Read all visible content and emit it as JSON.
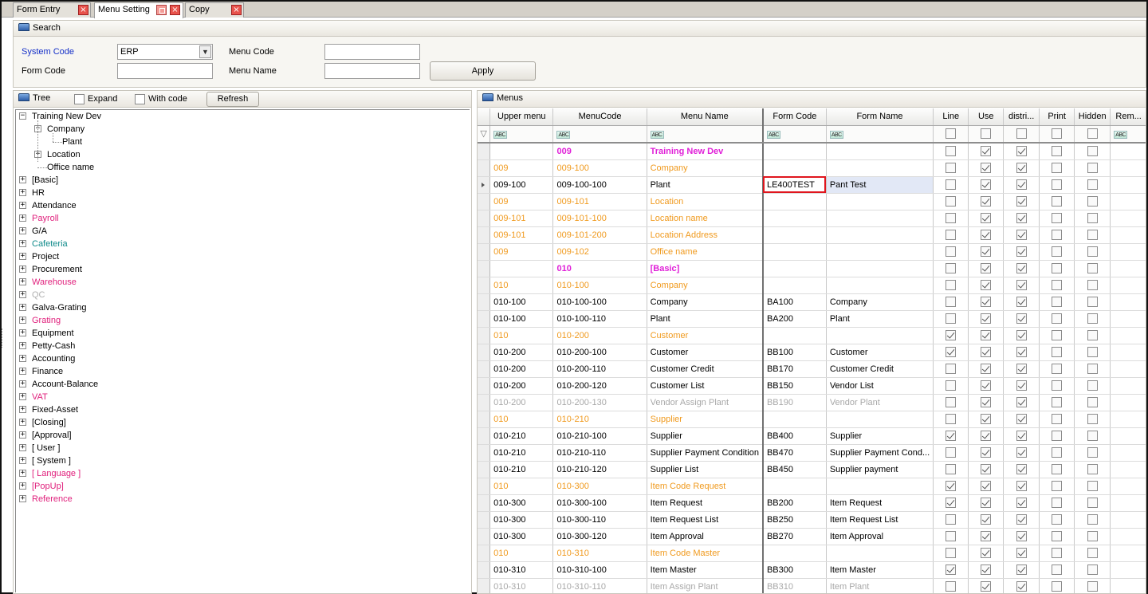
{
  "tabs": [
    {
      "label": "Form Entry"
    },
    {
      "label": "Menu Setting"
    },
    {
      "label": "Copy"
    }
  ],
  "search": {
    "title": "Search",
    "system_code_label": "System Code",
    "system_code_value": "ERP",
    "menu_code_label": "Menu Code",
    "menu_code_value": "",
    "form_code_label": "Form Code",
    "form_code_value": "",
    "menu_name_label": "Menu Name",
    "menu_name_value": "",
    "apply_label": "Apply"
  },
  "tree": {
    "title": "Tree",
    "expand_label": "Expand",
    "with_code_label": "With code",
    "refresh_label": "Refresh",
    "nodes": [
      {
        "label": "Training New Dev",
        "level": 0,
        "toggle": "minus",
        "color": "#000000"
      },
      {
        "label": "Company",
        "level": 1,
        "toggle": "minus",
        "color": "#000000"
      },
      {
        "label": "Plant",
        "level": 2,
        "toggle": "none",
        "color": "#000000"
      },
      {
        "label": "Location",
        "level": 1,
        "toggle": "plus",
        "color": "#000000"
      },
      {
        "label": "Office name",
        "level": 1,
        "toggle": "none",
        "color": "#000000"
      },
      {
        "label": "[Basic]",
        "level": 0,
        "toggle": "plus",
        "color": "#000000"
      },
      {
        "label": "HR",
        "level": 0,
        "toggle": "plus",
        "color": "#000000"
      },
      {
        "label": "Attendance",
        "level": 0,
        "toggle": "plus",
        "color": "#000000"
      },
      {
        "label": "Payroll",
        "level": 0,
        "toggle": "plus",
        "color": "#e0207c"
      },
      {
        "label": "G/A",
        "level": 0,
        "toggle": "plus",
        "color": "#000000"
      },
      {
        "label": "Cafeteria",
        "level": 0,
        "toggle": "plus",
        "color": "#0f8a8a"
      },
      {
        "label": "Project",
        "level": 0,
        "toggle": "plus",
        "color": "#000000"
      },
      {
        "label": "Procurement",
        "level": 0,
        "toggle": "plus",
        "color": "#000000"
      },
      {
        "label": "Warehouse",
        "level": 0,
        "toggle": "plus",
        "color": "#e0207c"
      },
      {
        "label": "QC",
        "level": 0,
        "toggle": "plus",
        "color": "#b0b0b0"
      },
      {
        "label": "Galva-Grating",
        "level": 0,
        "toggle": "plus",
        "color": "#000000"
      },
      {
        "label": "Grating",
        "level": 0,
        "toggle": "plus",
        "color": "#e0207c"
      },
      {
        "label": "Equipment",
        "level": 0,
        "toggle": "plus",
        "color": "#000000"
      },
      {
        "label": "Petty-Cash",
        "level": 0,
        "toggle": "plus",
        "color": "#000000"
      },
      {
        "label": "Accounting",
        "level": 0,
        "toggle": "plus",
        "color": "#000000"
      },
      {
        "label": "Finance",
        "level": 0,
        "toggle": "plus",
        "color": "#000000"
      },
      {
        "label": "Account-Balance",
        "level": 0,
        "toggle": "plus",
        "color": "#000000"
      },
      {
        "label": "VAT",
        "level": 0,
        "toggle": "plus",
        "color": "#e0207c"
      },
      {
        "label": "Fixed-Asset",
        "level": 0,
        "toggle": "plus",
        "color": "#000000"
      },
      {
        "label": "[Closing]",
        "level": 0,
        "toggle": "plus",
        "color": "#000000"
      },
      {
        "label": "[Approval]",
        "level": 0,
        "toggle": "plus",
        "color": "#000000"
      },
      {
        "label": "[ User ]",
        "level": 0,
        "toggle": "plus",
        "color": "#000000"
      },
      {
        "label": "[ System ]",
        "level": 0,
        "toggle": "plus",
        "color": "#000000"
      },
      {
        "label": "[ Language ]",
        "level": 0,
        "toggle": "plus",
        "color": "#e0207c"
      },
      {
        "label": "[PopUp]",
        "level": 0,
        "toggle": "plus",
        "color": "#e0207c"
      },
      {
        "label": "Reference",
        "level": 0,
        "toggle": "plus",
        "color": "#e0207c"
      }
    ]
  },
  "menus": {
    "title": "Menus",
    "columns": [
      "Upper menu",
      "MenuCode",
      "Menu Name",
      "Form Code",
      "Form Name",
      "Line",
      "Use",
      "distri...",
      "Print",
      "Hidden",
      "Rem..."
    ],
    "rows": [
      {
        "style": "magenta",
        "upper": "",
        "code": "009",
        "name": "Training New Dev",
        "form_code": "",
        "form_name": "",
        "line": false,
        "use": true,
        "distri": true,
        "print": false,
        "hidden": false
      },
      {
        "style": "orange",
        "upper": "009",
        "code": "009-100",
        "name": "Company",
        "form_code": "",
        "form_name": "",
        "line": false,
        "use": true,
        "distri": true,
        "print": false,
        "hidden": false
      },
      {
        "style": "black",
        "upper": "009-100",
        "code": "009-100-100",
        "name": "Plant",
        "form_code": "LE400TEST",
        "form_name": "Pant Test",
        "line": false,
        "use": true,
        "distri": true,
        "print": false,
        "hidden": false,
        "current": true
      },
      {
        "style": "orange",
        "upper": "009",
        "code": "009-101",
        "name": "Location",
        "form_code": "",
        "form_name": "",
        "line": false,
        "use": true,
        "distri": true,
        "print": false,
        "hidden": false
      },
      {
        "style": "orange",
        "upper": "009-101",
        "code": "009-101-100",
        "name": "Location name",
        "form_code": "",
        "form_name": "",
        "line": false,
        "use": true,
        "distri": true,
        "print": false,
        "hidden": false
      },
      {
        "style": "orange",
        "upper": "009-101",
        "code": "009-101-200",
        "name": "Location Address",
        "form_code": "",
        "form_name": "",
        "line": false,
        "use": true,
        "distri": true,
        "print": false,
        "hidden": false
      },
      {
        "style": "orange",
        "upper": "009",
        "code": "009-102",
        "name": "Office name",
        "form_code": "",
        "form_name": "",
        "line": false,
        "use": true,
        "distri": true,
        "print": false,
        "hidden": false
      },
      {
        "style": "magenta",
        "upper": "",
        "code": "010",
        "name": "[Basic]",
        "form_code": "",
        "form_name": "",
        "line": false,
        "use": true,
        "distri": true,
        "print": false,
        "hidden": false
      },
      {
        "style": "orange",
        "upper": "010",
        "code": "010-100",
        "name": "Company",
        "form_code": "",
        "form_name": "",
        "line": false,
        "use": true,
        "distri": true,
        "print": false,
        "hidden": false
      },
      {
        "style": "black",
        "upper": "010-100",
        "code": "010-100-100",
        "name": "Company",
        "form_code": "BA100",
        "form_name": "Company",
        "line": false,
        "use": true,
        "distri": true,
        "print": false,
        "hidden": false
      },
      {
        "style": "black",
        "upper": "010-100",
        "code": "010-100-110",
        "name": "Plant",
        "form_code": "BA200",
        "form_name": "Plant",
        "line": false,
        "use": true,
        "distri": true,
        "print": false,
        "hidden": false
      },
      {
        "style": "orange",
        "upper": "010",
        "code": "010-200",
        "name": "Customer",
        "form_code": "",
        "form_name": "",
        "line": true,
        "use": true,
        "distri": true,
        "print": false,
        "hidden": false
      },
      {
        "style": "black",
        "upper": "010-200",
        "code": "010-200-100",
        "name": "Customer",
        "form_code": "BB100",
        "form_name": "Customer",
        "line": true,
        "use": true,
        "distri": true,
        "print": false,
        "hidden": false
      },
      {
        "style": "black",
        "upper": "010-200",
        "code": "010-200-110",
        "name": "Customer Credit",
        "form_code": "BB170",
        "form_name": "Customer Credit",
        "line": false,
        "use": true,
        "distri": true,
        "print": false,
        "hidden": false
      },
      {
        "style": "black",
        "upper": "010-200",
        "code": "010-200-120",
        "name": "Customer List",
        "form_code": "BB150",
        "form_name": "Vendor List",
        "line": false,
        "use": true,
        "distri": true,
        "print": false,
        "hidden": false
      },
      {
        "style": "gray",
        "upper": "010-200",
        "code": "010-200-130",
        "name": "Vendor Assign Plant",
        "form_code": "BB190",
        "form_name": "Vendor Plant",
        "line": false,
        "use": true,
        "distri": true,
        "print": false,
        "hidden": false
      },
      {
        "style": "orange",
        "upper": "010",
        "code": "010-210",
        "name": "Supplier",
        "form_code": "",
        "form_name": "",
        "line": false,
        "use": true,
        "distri": true,
        "print": false,
        "hidden": false
      },
      {
        "style": "black",
        "upper": "010-210",
        "code": "010-210-100",
        "name": "Supplier",
        "form_code": "BB400",
        "form_name": "Supplier",
        "line": true,
        "use": true,
        "distri": true,
        "print": false,
        "hidden": false
      },
      {
        "style": "black",
        "upper": "010-210",
        "code": "010-210-110",
        "name": "Supplier Payment Condition",
        "form_code": "BB470",
        "form_name": "Supplier Payment Cond...",
        "line": false,
        "use": true,
        "distri": true,
        "print": false,
        "hidden": false
      },
      {
        "style": "black",
        "upper": "010-210",
        "code": "010-210-120",
        "name": "Supplier List",
        "form_code": "BB450",
        "form_name": "Supplier payment",
        "line": false,
        "use": true,
        "distri": true,
        "print": false,
        "hidden": false
      },
      {
        "style": "orange",
        "upper": "010",
        "code": "010-300",
        "name": "Item Code Request",
        "form_code": "",
        "form_name": "",
        "line": true,
        "use": true,
        "distri": true,
        "print": false,
        "hidden": false
      },
      {
        "style": "black",
        "upper": "010-300",
        "code": "010-300-100",
        "name": "Item Request",
        "form_code": "BB200",
        "form_name": "Item Request",
        "line": true,
        "use": true,
        "distri": true,
        "print": false,
        "hidden": false
      },
      {
        "style": "black",
        "upper": "010-300",
        "code": "010-300-110",
        "name": "Item Request List",
        "form_code": "BB250",
        "form_name": "Item Request List",
        "line": false,
        "use": true,
        "distri": true,
        "print": false,
        "hidden": false
      },
      {
        "style": "black",
        "upper": "010-300",
        "code": "010-300-120",
        "name": "Item Approval",
        "form_code": "BB270",
        "form_name": "Item Approval",
        "line": false,
        "use": true,
        "distri": true,
        "print": false,
        "hidden": false
      },
      {
        "style": "orange",
        "upper": "010",
        "code": "010-310",
        "name": "Item Code Master",
        "form_code": "",
        "form_name": "",
        "line": false,
        "use": true,
        "distri": true,
        "print": false,
        "hidden": false
      },
      {
        "style": "black",
        "upper": "010-310",
        "code": "010-310-100",
        "name": "Item Master",
        "form_code": "BB300",
        "form_name": "Item Master",
        "line": true,
        "use": true,
        "distri": true,
        "print": false,
        "hidden": false
      },
      {
        "style": "gray",
        "upper": "010-310",
        "code": "010-310-110",
        "name": "Item Assign Plant",
        "form_code": "BB310",
        "form_name": "Item Plant",
        "line": false,
        "use": true,
        "distri": true,
        "print": false,
        "hidden": false
      }
    ]
  },
  "icons": {
    "close": "close-icon",
    "restore": "restore-icon",
    "panel": "panel-icon",
    "filter": "filter-icon",
    "abc_filter": "text-filter-icon",
    "dropdown": "chevron-down-icon"
  },
  "colors": {
    "orange": "#f09a1e",
    "magenta": "#e020d8",
    "gray": "#a8a8a8",
    "label_blue": "#1530c8",
    "selection_red": "#e0161e"
  }
}
